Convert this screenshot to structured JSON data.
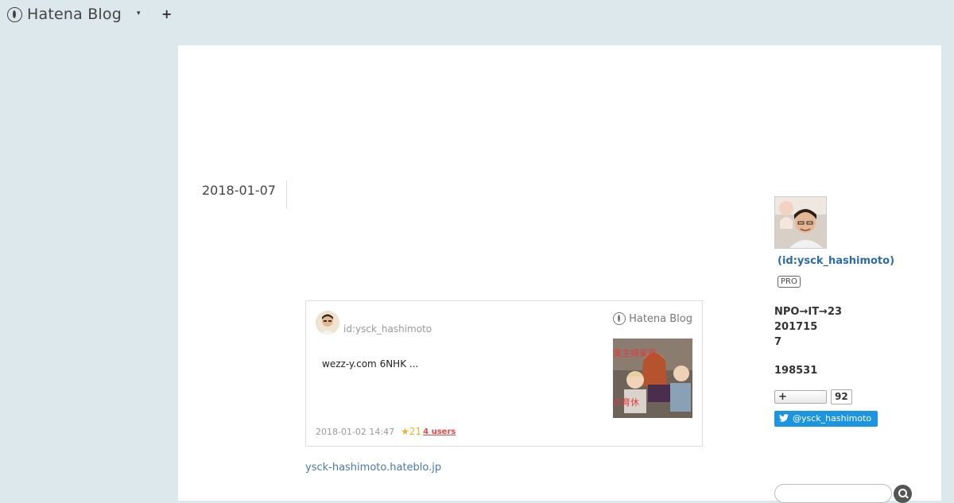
{
  "header": {
    "brand": "Hatena Blog",
    "caret": "▾",
    "plus": "+"
  },
  "entry": {
    "date": "2018-01-07"
  },
  "card": {
    "author": "id:ysck_hashimoto",
    "logo_text": "Hatena Blog",
    "excerpt": "wezz-y.com 6NHK ...",
    "thumbnail_caption_top": "業主婦家庭",
    "thumbnail_caption_bottom": "の育休",
    "timestamp": "2018-01-02 14:47",
    "stars": "★21",
    "users": "4 users"
  },
  "blog_link": "ysck-hashimoto.hateblo.jp",
  "sidebar": {
    "id": "(id:ysck_hashimoto)",
    "badge": "PRO",
    "bio_lines": [
      "NPO→IT→23",
      "201715",
      "7"
    ],
    "readers": "198531",
    "follow_label": "+",
    "follow_count": "92",
    "twitter_label": "@ysck_hashimoto"
  },
  "colors": {
    "background": "#dce8ec",
    "link": "#2b6ca3",
    "twitter": "#1b95e0",
    "star": "#e5b531",
    "users": "#e0494a"
  }
}
